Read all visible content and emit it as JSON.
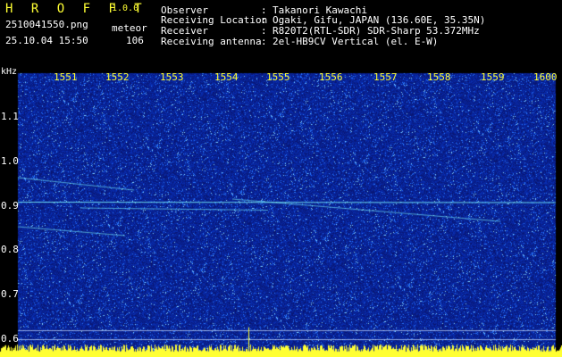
{
  "app": {
    "title": "H R O F F T",
    "version": "1.0.0"
  },
  "file": {
    "name": "2510041550.png",
    "datetime": "25.10.04 15:50"
  },
  "meteor": {
    "label": "meteor",
    "count": "106"
  },
  "info": [
    {
      "key": "Observer",
      "sep": ":",
      "value": "Takanori Kawachi"
    },
    {
      "key": "Receiving Location",
      "sep": ":",
      "value": "Ogaki, Gifu, JAPAN (136.60E, 35.35N)"
    },
    {
      "key": "Receiver",
      "sep": ":",
      "value": "R820T2(RTL-SDR) SDR-Sharp 53.372MHz"
    },
    {
      "key": "Receiving antenna",
      "sep": ":",
      "value": "2el-HB9CV Vertical (el. E-W)"
    }
  ],
  "axis": {
    "y_unit": "kHz",
    "x_ticks": [
      "1551",
      "1552",
      "1553",
      "1554",
      "1555",
      "1556",
      "1557",
      "1558",
      "1559",
      "1600"
    ],
    "y_ticks": [
      "1.1",
      "1.0",
      "0.9",
      "0.8",
      "0.7",
      "0.6"
    ]
  },
  "colors": {
    "background": "#000000",
    "spectrogram_base": "#0a1a8c",
    "accent_text": "#ffff33",
    "trace": "#7cf7ff"
  }
}
